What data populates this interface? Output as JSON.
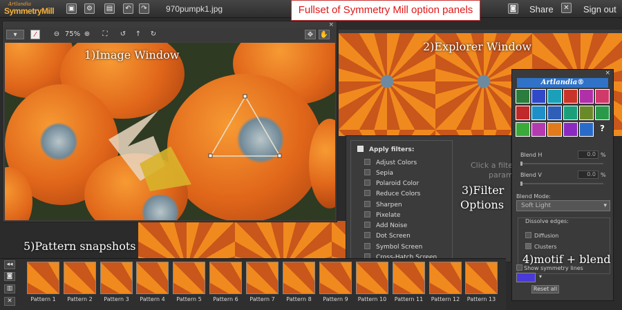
{
  "topbar": {
    "logo_small": "Artlandia",
    "logo_main": "SymmetryMill",
    "icons": [
      "new-icon",
      "open-icon",
      "save-icon",
      "undo-icon",
      "redo-icon"
    ],
    "filename": "970pumpk1.jpg",
    "share_label": "Share",
    "signout_label": "Sign out"
  },
  "title_note": "Fullset of Symmetry Mill option panels",
  "image_window": {
    "label": "1)Image Window",
    "zoom": "75%",
    "close": "×"
  },
  "explorer": {
    "label": "2)Explorer Window"
  },
  "filters": {
    "label_line1": "3)Filter",
    "label_line2": "Options",
    "apply_label": "Apply filters:",
    "items": [
      "Adjust Colors",
      "Sepia",
      "Polaroid Color",
      "Reduce Colors",
      "Sharpen",
      "Pixelate",
      "Add Noise",
      "Dot Screen",
      "Symbol Screen",
      "Cross-Hatch Screen"
    ],
    "hint_line1": "Click a filter",
    "hint_line2": "param"
  },
  "motif": {
    "label": "4)motif + blend",
    "brand": "Artlandia®",
    "help": "?",
    "close": "×",
    "blend_h_label": "Blend H",
    "blend_h_value": "0.0",
    "blend_v_label": "Blend V",
    "blend_v_value": "0.0",
    "percent": "%",
    "blend_mode_label": "Blend Mode:",
    "blend_mode_value": "Soft Light",
    "dissolve_label": "Dissolve edges:",
    "diffusion_label": "Diffusion",
    "clusters_label": "Clusters",
    "show_lines_label": "Show symmetry lines",
    "reset_label": "Reset all",
    "swatch_color": "#4a3ad8",
    "tile_colors": [
      "#2a7d3c",
      "#2f49c9",
      "#1aa0b8",
      "#c9342a",
      "#b030a8",
      "#d03a6a",
      "#c0282a",
      "#1e8fc8",
      "#2e5fb8",
      "#1a9f7a",
      "#6a8a2a",
      "#2a9a4a",
      "#3aaa3a",
      "#b43ab0",
      "#e07a1a",
      "#8a2ac0",
      "#2a6ac8"
    ]
  },
  "snapshots": {
    "label": "5)Pattern snapshots",
    "items": [
      "Pattern 1",
      "Pattern 2",
      "Pattern 3",
      "Pattern 4",
      "Pattern 5",
      "Pattern 6",
      "Pattern 7",
      "Pattern 8",
      "Pattern 9",
      "Pattern 10",
      "Pattern 11",
      "Pattern 12",
      "Pattern 13"
    ]
  }
}
